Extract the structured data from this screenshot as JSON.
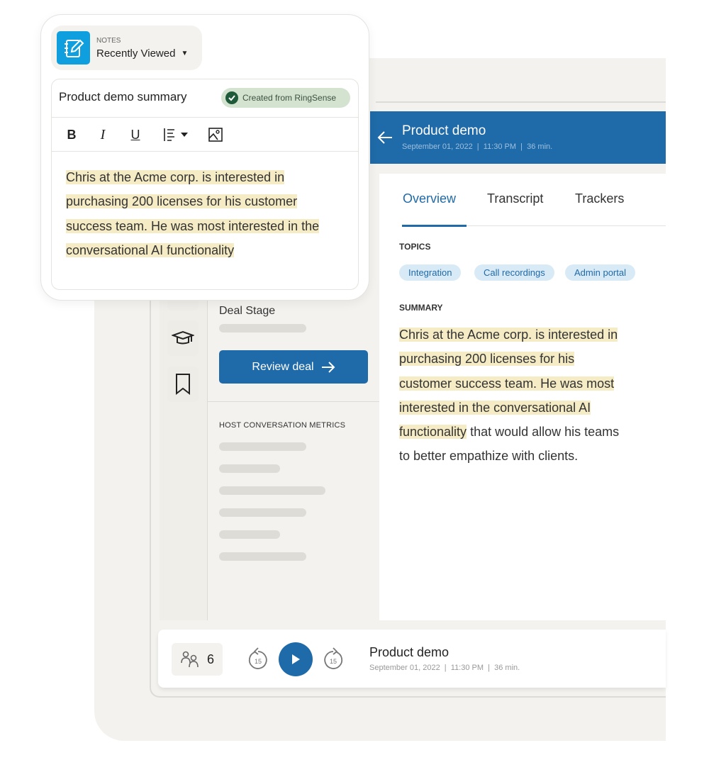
{
  "colors": {
    "brand_blue": "#1f6aa8",
    "notes_icon": "#0f9fde",
    "highlight": "#f5ebc4",
    "badge_bg": "#d4e3d0",
    "chip_bg": "#d9eaf7"
  },
  "notes": {
    "caption": "NOTES",
    "view_selector": "Recently Viewed",
    "note_title": "Product demo summary",
    "badge": "Created from RingSense",
    "toolbar": {
      "bold": "B",
      "italic": "I",
      "underline": "U",
      "icons": [
        "bold-icon",
        "italic-icon",
        "underline-icon",
        "align-icon",
        "image-icon"
      ]
    },
    "body_lines": [
      {
        "hl": "Chris at the Acme corp. is interested in",
        "rest": ""
      },
      {
        "hl": "purchasing 200 licenses for his customer",
        "rest": ""
      },
      {
        "hl": "success team. He was most interested in the",
        "rest": ""
      },
      {
        "hl": "conversational AI functionality",
        "rest": ""
      }
    ]
  },
  "sidebar": {
    "icons": [
      "graduation-cap-icon",
      "bookmark-icon"
    ]
  },
  "deal": {
    "label": "Deal Stage",
    "review_button": "Review deal",
    "metrics_label": "HOST CONVERSATION METRICS"
  },
  "call": {
    "title": "Product demo",
    "meta": "September 01, 2022  |  11:30 PM  |  36 min.",
    "tabs": [
      {
        "label": "Overview",
        "active": true
      },
      {
        "label": "Transcript",
        "active": false
      },
      {
        "label": "Trackers",
        "active": false
      }
    ],
    "topics_label": "TOPICS",
    "topics": [
      "Integration",
      "Call recordings",
      "Admin portal"
    ],
    "summary_label": "SUMMARY",
    "summary_lines": [
      {
        "hl": "Chris at the Acme corp. is interested in",
        "rest": ""
      },
      {
        "hl": "purchasing 200 licenses for his",
        "rest": ""
      },
      {
        "hl": "customer success team. He was most",
        "rest": ""
      },
      {
        "hl": "interested in the conversational AI",
        "rest": ""
      },
      {
        "hl": "functionality",
        "rest": " that would allow his teams"
      },
      {
        "hl": "",
        "rest": "to better empathize with clients."
      }
    ]
  },
  "player": {
    "participants": "6",
    "skip_back": "15",
    "skip_forward": "15",
    "title": "Product demo",
    "meta": "September 01, 2022  |  11:30 PM  |  36 min."
  }
}
